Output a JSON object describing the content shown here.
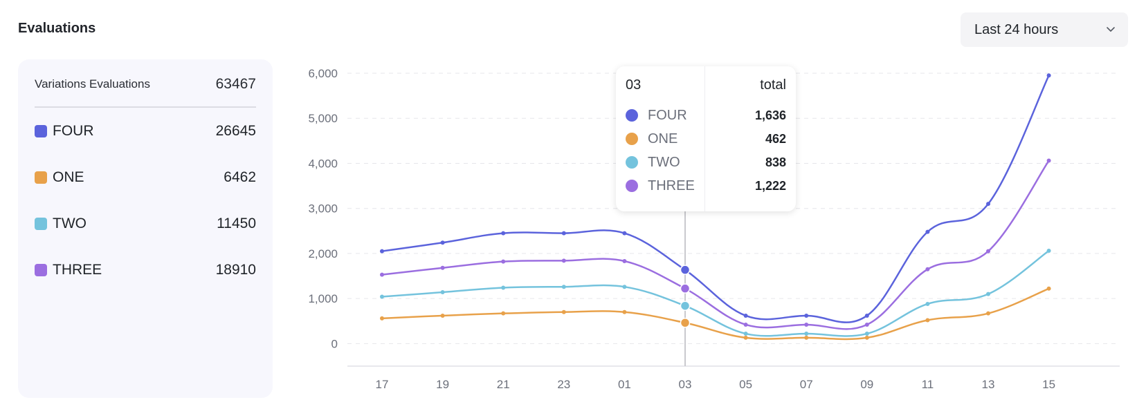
{
  "header": {
    "title": "Evaluations",
    "range_label": "Last 24 hours"
  },
  "summary": {
    "heading": "Variations Evaluations",
    "total": "63467",
    "items": [
      {
        "name": "FOUR",
        "value": "26645",
        "color": "#5b63dc"
      },
      {
        "name": "ONE",
        "value": "6462",
        "color": "#e8a14a"
      },
      {
        "name": "TWO",
        "value": "11450",
        "color": "#74c3dd"
      },
      {
        "name": "THREE",
        "value": "18910",
        "color": "#9b6ee0"
      }
    ]
  },
  "tooltip": {
    "x_label": "03",
    "total_label": "total",
    "rows": [
      {
        "name": "FOUR",
        "value": "1,636",
        "color": "#5b63dc"
      },
      {
        "name": "ONE",
        "value": "462",
        "color": "#e8a14a"
      },
      {
        "name": "TWO",
        "value": "838",
        "color": "#74c3dd"
      },
      {
        "name": "THREE",
        "value": "1,222",
        "color": "#9b6ee0"
      }
    ]
  },
  "chart_data": {
    "type": "line",
    "x": [
      "17",
      "19",
      "21",
      "23",
      "01",
      "03",
      "05",
      "07",
      "09",
      "11",
      "13",
      "15"
    ],
    "ylim": [
      -500,
      6000
    ],
    "yticks": [
      0,
      1000,
      2000,
      3000,
      4000,
      5000,
      6000
    ],
    "ytick_labels": [
      "0",
      "1,000",
      "2,000",
      "3,000",
      "4,000",
      "5,000",
      "6,000"
    ],
    "grid": true,
    "hover_index": 5,
    "series": [
      {
        "name": "FOUR",
        "color": "#5b63dc",
        "values": [
          2050,
          2240,
          2450,
          2450,
          2450,
          1636,
          620,
          620,
          620,
          2480,
          3100,
          5950
        ]
      },
      {
        "name": "ONE",
        "color": "#e8a14a",
        "values": [
          560,
          620,
          670,
          700,
          700,
          462,
          130,
          130,
          130,
          520,
          670,
          1220
        ]
      },
      {
        "name": "TWO",
        "color": "#74c3dd",
        "values": [
          1040,
          1140,
          1240,
          1260,
          1260,
          838,
          220,
          220,
          220,
          880,
          1100,
          2060
        ]
      },
      {
        "name": "THREE",
        "color": "#9b6ee0",
        "values": [
          1530,
          1680,
          1820,
          1840,
          1830,
          1222,
          420,
          420,
          420,
          1650,
          2050,
          4060
        ]
      }
    ]
  }
}
